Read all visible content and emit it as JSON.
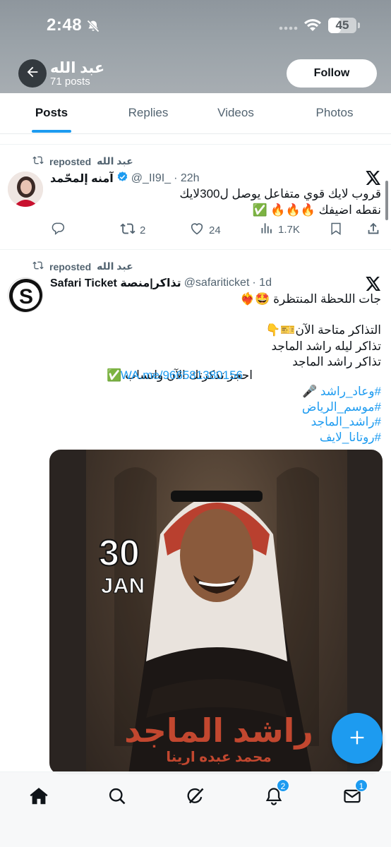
{
  "status_bar": {
    "time": "2:48",
    "battery_level": 45,
    "battery_text": "45"
  },
  "profile": {
    "name": "عبد الله",
    "posts_count": "71 posts",
    "follow_label": "Follow"
  },
  "tabs": [
    {
      "label": "Posts",
      "active": true
    },
    {
      "label": "Replies",
      "active": false
    },
    {
      "label": "Videos",
      "active": false
    },
    {
      "label": "Photos",
      "active": false
    }
  ],
  "posts": [
    {
      "repost_label": "reposted",
      "reposter": "عبد الله",
      "author_name": "آمنه إلمحّمد",
      "verified": true,
      "handle": "@_II9I_",
      "time": "· 22h",
      "source_icon": "x-logo",
      "lines": [
        "قروب لايك قوي متفاعل يوصل ل300لايك",
        "نقطه اضيفك 🔥🔥🔥 ✅"
      ],
      "stats": {
        "replies": "",
        "reposts": "2",
        "likes": "24",
        "views": "1.7K"
      }
    },
    {
      "repost_label": "reposted",
      "reposter": "عبد الله",
      "author_name": "Safari Ticket تذاكر|منصة",
      "verified": false,
      "handle": "@safariticket",
      "time": "· 1d",
      "source_icon": "x-logo",
      "lines": [
        "جات اللحظة المنتظرة 🤩❤️‍🔥",
        "",
        "التذاكر متاحة الآن🎫👇",
        "تذاكر ليله راشد الماجد",
        "تذاكر راشد الماجد",
        "احجز تذكرتك الآن واتساب ✅"
      ],
      "link": "WA.me/966581380156",
      "hashtags": [
        "#وعاد_راشد 🎤",
        "#موسم_الرياض",
        "#راشد_الماجد",
        "#روتانا_لايف"
      ],
      "poster": {
        "day": "30",
        "month": "JAN",
        "title": "راشد الماجد",
        "subtitle": "محمد عبده ارينا"
      }
    }
  ],
  "bottom_nav": {
    "items": [
      {
        "name": "home",
        "badge": ""
      },
      {
        "name": "search",
        "badge": ""
      },
      {
        "name": "grok",
        "badge": ""
      },
      {
        "name": "notifications",
        "badge": "2"
      },
      {
        "name": "messages",
        "badge": "1"
      }
    ]
  },
  "colors": {
    "accent": "#1d9bf0",
    "text": "#0f1419",
    "muted": "#536471",
    "header_bg": "#9aa2a8"
  }
}
